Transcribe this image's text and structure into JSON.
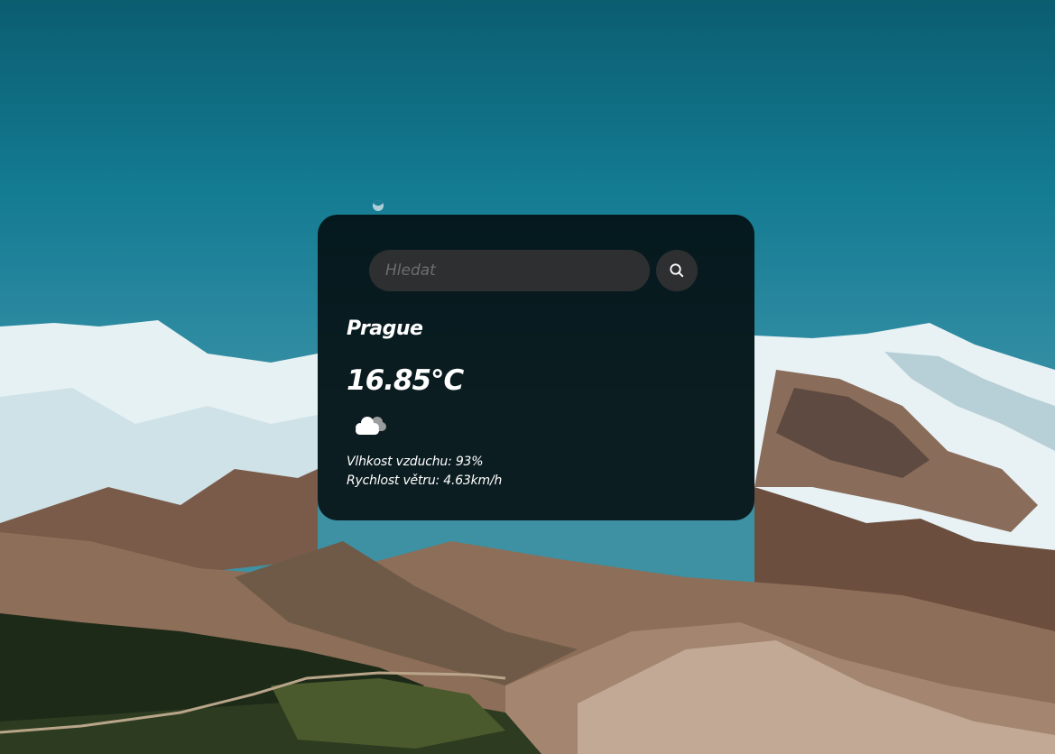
{
  "search": {
    "placeholder": "Hledat",
    "value": "",
    "button_icon": "search-icon"
  },
  "weather": {
    "city": "Prague",
    "temperature": "16.85°C",
    "condition_icon": "cloud-icon",
    "humidity_text": "Vlhkost vzduchu: 93%",
    "wind_text": "Rychlost větru: 4.63km/h"
  },
  "colors": {
    "card_background": "rgba(0,0,0,0.80)",
    "input_background": "#2e2f30",
    "text": "#ffffff",
    "placeholder": "#6b6d6f",
    "sky": "#137b92"
  }
}
